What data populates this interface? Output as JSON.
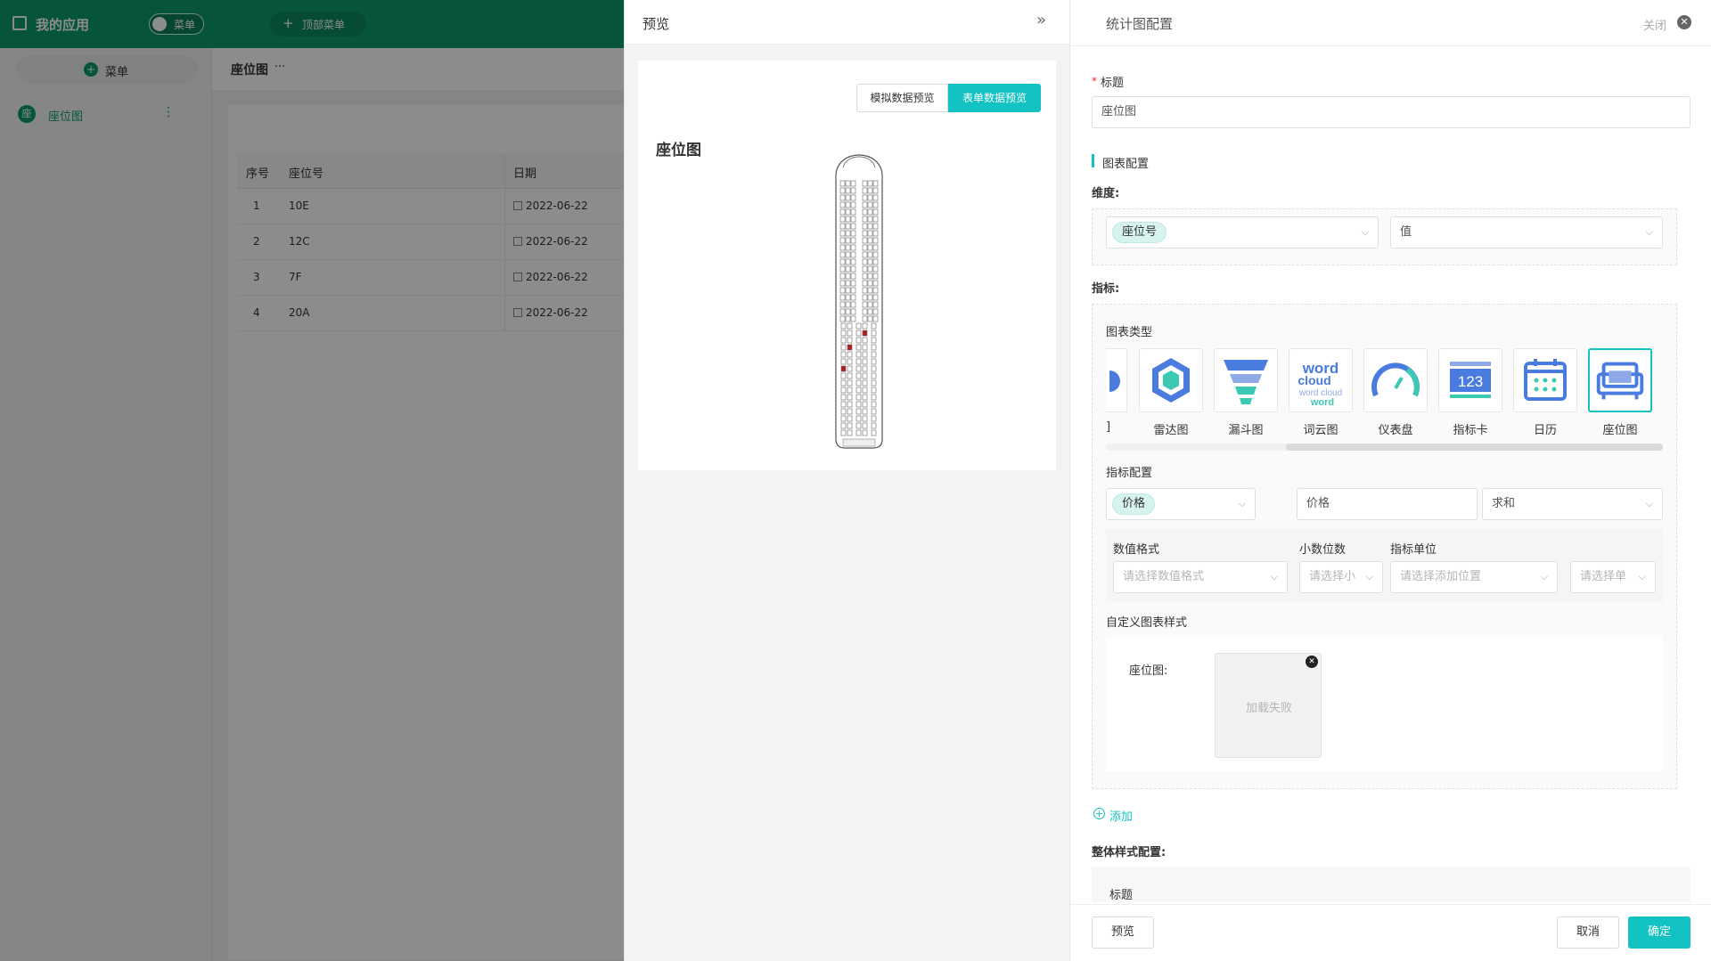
{
  "app": {
    "title": "我的应用",
    "toggle_label": "菜单",
    "top_menu_label": "顶部菜单",
    "add_menu_label": "菜单",
    "sidebar_items": [
      {
        "icon_text": "座",
        "label": "座位图"
      }
    ],
    "page_title": "座位图",
    "page_more": "···"
  },
  "table": {
    "columns": [
      "序号",
      "座位号",
      "日期"
    ],
    "rows": [
      {
        "index": "1",
        "seat": "10E",
        "date": "2022-06-22"
      },
      {
        "index": "2",
        "seat": "12C",
        "date": "2022-06-22"
      },
      {
        "index": "3",
        "seat": "7F",
        "date": "2022-06-22"
      },
      {
        "index": "4",
        "seat": "20A",
        "date": "2022-06-22"
      }
    ]
  },
  "preview": {
    "header": "预览",
    "collapse_icon": "double-chevron-right-icon",
    "tab_mock": "模拟数据预览",
    "tab_form": "表单数据预览",
    "chart_title": "座位图"
  },
  "config": {
    "header": "统计图配置",
    "close_label": "关闭",
    "title_label": "标题",
    "title_value": "座位图",
    "section_chart": "图表配置",
    "dimension_label": "维度:",
    "dimension_tag": "座位号",
    "dimension_value": "值",
    "metric_label": "指标:",
    "chart_type_label": "图表类型",
    "chart_types": [
      "雷达图",
      "漏斗图",
      "词云图",
      "仪表盘",
      "指标卡",
      "日历",
      "座位图"
    ],
    "partial_type_label": "]",
    "metric_config_label": "指标配置",
    "metric_tag": "价格",
    "metric_name": "价格",
    "metric_agg": "求和",
    "num_format_label": "数值格式",
    "decimals_label": "小数位数",
    "unit_label": "指标单位",
    "num_format_ph": "请选择数值格式",
    "decimals_ph": "请选择小",
    "unit_pos_ph": "请选择添加位置",
    "unit_ph": "请选择单",
    "custom_style_label": "自定义图表样式",
    "seat_img_label": "座位图:",
    "load_failed": "加载失败",
    "add_label": "添加",
    "overall_style_label": "整体样式配置:",
    "overall_title_label": "标题",
    "btn_preview": "预览",
    "btn_cancel": "取消",
    "btn_ok": "确定",
    "accent": "#13c2c2",
    "brand": "#0b9a6c"
  }
}
